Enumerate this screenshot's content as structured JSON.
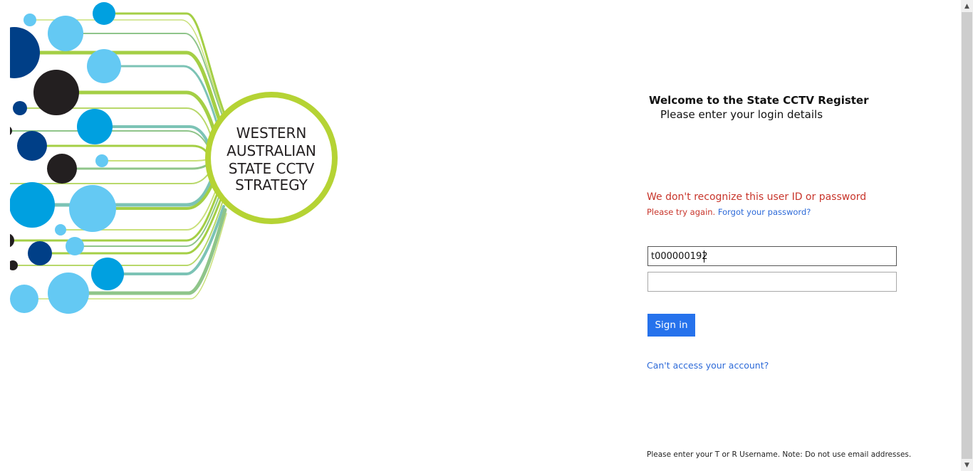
{
  "logo": {
    "line1": "WESTERN",
    "line2": "AUSTRALIAN",
    "line3": "STATE CCTV",
    "line4": "STRATEGY",
    "ring_color": "#b5d334",
    "dot_colors": [
      "#64c9f3",
      "#00a0e0",
      "#003f87",
      "#231f20"
    ]
  },
  "login": {
    "welcome_title": "Welcome to the State CCTV Register",
    "welcome_subtitle": "Please enter your login details",
    "error_title": "We don't recognize this user ID or password",
    "error_try_again": "Please try again.",
    "forgot_password": "Forgot your password?",
    "username_value": "t000000192",
    "password_value": "",
    "sign_in_label": "Sign in",
    "cant_access": "Can't access your account?",
    "note": "Please enter your T or R Username. Note: Do not use email addresses."
  },
  "scrollbar": {
    "up_arrow_icon": "▲",
    "down_arrow_icon": "▼"
  },
  "colors": {
    "error": "#c8352b",
    "link": "#2d6ad8",
    "button": "#2672ec"
  }
}
